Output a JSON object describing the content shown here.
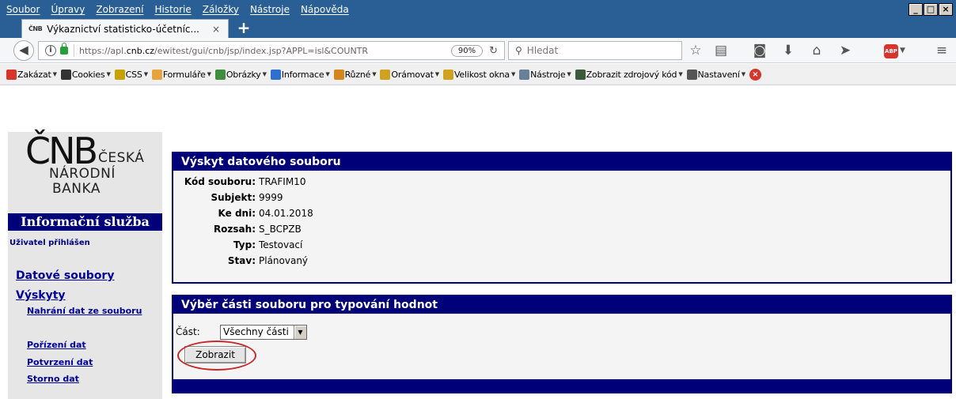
{
  "menu": [
    "Soubor",
    "Úpravy",
    "Zobrazení",
    "Historie",
    "Záložky",
    "Nástroje",
    "Nápověda"
  ],
  "window_controls": [
    "_",
    "□",
    "×"
  ],
  "tab": {
    "favicon": "ČNB",
    "title": "Výkaznictví statisticko-účetníc...",
    "close": "×",
    "new_tab": "+"
  },
  "nav": {
    "back_icon": "back-arrow-icon",
    "url_host_prefix": "https://apl.",
    "url_host": "cnb.cz",
    "url_path": "/ewitest/gui/cnb/jsp/index.jsp?APPL=isl&COUNTR",
    "zoom": "90%",
    "search_placeholder": "Hledat",
    "icons": [
      "star-icon",
      "library-icon",
      "pocket-icon",
      "download-icon",
      "home-icon",
      "send-icon"
    ],
    "abp": "ABP",
    "menu_icon": "hamburger-icon"
  },
  "devtoolbar": [
    {
      "label": "Zakázat",
      "color": "#d9342b"
    },
    {
      "label": "Cookies",
      "color": "#333333"
    },
    {
      "label": "CSS",
      "color": "#c8a200"
    },
    {
      "label": "Formuláře",
      "color": "#e8a33c"
    },
    {
      "label": "Obrázky",
      "color": "#3f8d3f"
    },
    {
      "label": "Informace",
      "color": "#2f6fd0"
    },
    {
      "label": "Různé",
      "color": "#d4861c"
    },
    {
      "label": "Orámovat",
      "color": "#d1a21f"
    },
    {
      "label": "Velikost okna",
      "color": "#d1a21f"
    },
    {
      "label": "Nástroje",
      "color": "#6a7f98"
    },
    {
      "label": "Zobrazit zdrojový kód",
      "color": "#3a5a3a"
    },
    {
      "label": "Nastavení",
      "color": "#555555"
    }
  ],
  "logo": {
    "big": "ČNB",
    "line1": "ČESKÁ",
    "line2": "NÁRODNÍ",
    "line3": "BANKA"
  },
  "sidebar": {
    "title": "Informační služba",
    "user_status": "Uživatel přihlášen",
    "links": {
      "datove_soubory": "Datové soubory",
      "vyskyty": "Výskyty",
      "nahrani": "Nahrání dat ze souboru",
      "porizeni": "Pořízení dat",
      "potvrzeni": "Potvrzení dat",
      "storno": "Storno dat"
    }
  },
  "panel1": {
    "title": "Výskyt datového souboru",
    "fields": [
      {
        "label": "Kód souboru:",
        "value": "TRAFIM10"
      },
      {
        "label": "Subjekt:",
        "value": "9999"
      },
      {
        "label": "Ke dni:",
        "value": "04.01.2018"
      },
      {
        "label": "Rozsah:",
        "value": "S_BCPZB"
      },
      {
        "label": "Typ:",
        "value": "Testovací"
      },
      {
        "label": "Stav:",
        "value": "Plánovaný"
      }
    ]
  },
  "panel2": {
    "title": "Výběr části souboru pro typování hodnot",
    "part_label": "Část:",
    "part_selected": "Všechny části",
    "submit": "Zobrazit"
  }
}
